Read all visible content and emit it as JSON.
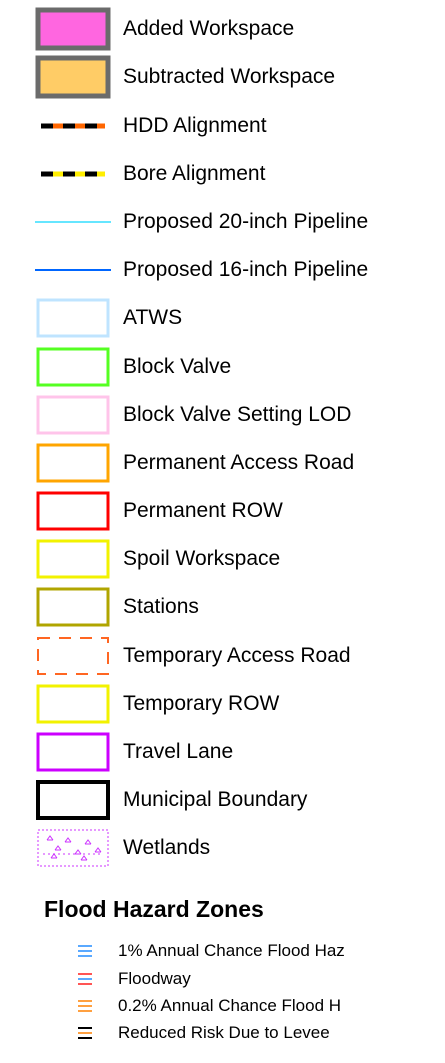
{
  "legend": {
    "items": [
      {
        "label": "Added Workspace",
        "symbol": "fill-box",
        "fill": "#ff66e0",
        "stroke": "#6b6b6b"
      },
      {
        "label": "Subtracted Workspace",
        "symbol": "fill-box",
        "fill": "#ffcc66",
        "stroke": "#6b6b6b"
      },
      {
        "label": "HDD Alignment",
        "symbol": "dashed-line",
        "color": "#ff6600",
        "dash_color": "#000000"
      },
      {
        "label": "Bore Alignment",
        "symbol": "dashed-line",
        "color": "#ffee00",
        "dash_color": "#000000"
      },
      {
        "label": "Proposed 20-inch Pipeline",
        "symbol": "line",
        "color": "#66e6ff"
      },
      {
        "label": "Proposed 16-inch Pipeline",
        "symbol": "line",
        "color": "#0066ff"
      },
      {
        "label": "ATWS",
        "symbol": "outline-box",
        "color": "#bfe4ff"
      },
      {
        "label": "Block Valve",
        "symbol": "outline-box",
        "color": "#55ff22"
      },
      {
        "label": "Block Valve Setting LOD",
        "symbol": "outline-box",
        "color": "#ffc4ea"
      },
      {
        "label": "Permanent Access Road",
        "symbol": "outline-box",
        "color": "#ffa500"
      },
      {
        "label": "Permanent ROW",
        "symbol": "outline-box",
        "color": "#ff0000"
      },
      {
        "label": "Spoil Workspace",
        "symbol": "outline-box",
        "color": "#f2f200"
      },
      {
        "label": "Stations",
        "symbol": "outline-box",
        "color": "#b0a500"
      },
      {
        "label": "Temporary Access Road",
        "symbol": "dashed-box",
        "color": "#ff6622"
      },
      {
        "label": "Temporary ROW",
        "symbol": "outline-box",
        "color": "#f2f200"
      },
      {
        "label": "Travel Lane",
        "symbol": "outline-box",
        "color": "#cc00ff"
      },
      {
        "label": "Municipal Boundary",
        "symbol": "outline-box",
        "color": "#000000"
      },
      {
        "label": "Wetlands",
        "symbol": "wetland-box",
        "color": "#cc33ff"
      }
    ]
  },
  "flood": {
    "heading": "Flood Hazard Zones",
    "items": [
      {
        "label": "1% Annual Chance Flood Haz",
        "colors": [
          "#5aa9ff",
          "#5aa9ff",
          "#5aa9ff"
        ]
      },
      {
        "label": "Floodway",
        "colors": [
          "#ff5555",
          "#5aa9ff",
          "#ff5555"
        ]
      },
      {
        "label": "0.2% Annual Chance Flood H",
        "colors": [
          "#ffa040",
          "#ffa040",
          "#ffa040"
        ]
      },
      {
        "label": "Reduced Risk Due to Levee",
        "colors": [
          "#000000",
          "#ffa040",
          "#000000"
        ]
      }
    ]
  }
}
